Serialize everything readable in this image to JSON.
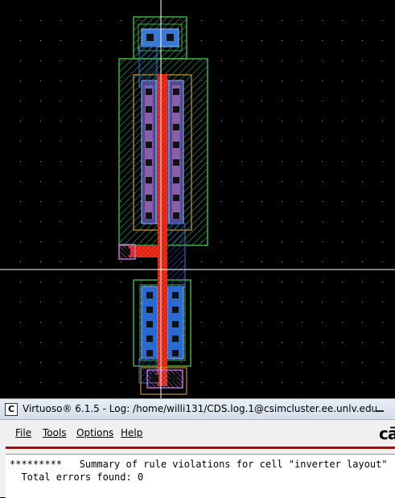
{
  "layout_view": {
    "background": "#000000",
    "colors": {
      "nwell": "#2e8b57",
      "select": "#3cb043",
      "active_hatch": "#4a8c5c",
      "pdiff_box": "#c89020",
      "metal1": "#3a78d8",
      "poly": "#e02010",
      "contact": "#101010",
      "via": "#9a4aa0",
      "crosshair": "#ffffff"
    }
  },
  "window": {
    "app_icon": "C",
    "title": "Virtuoso® 6.1.5 - Log: /home/willi131/CDS.log.1@csimcluster.ee.unlv.edu",
    "minimize_icon": "minimize-icon",
    "menu": [
      {
        "label": "File"
      },
      {
        "label": "Tools"
      },
      {
        "label": "Options"
      },
      {
        "label": "Help"
      }
    ],
    "brand": "cā",
    "log_lines": [
      "*********   Summary of rule violations for cell \"inverter layout\"   *",
      "  Total errors found: 0"
    ]
  }
}
